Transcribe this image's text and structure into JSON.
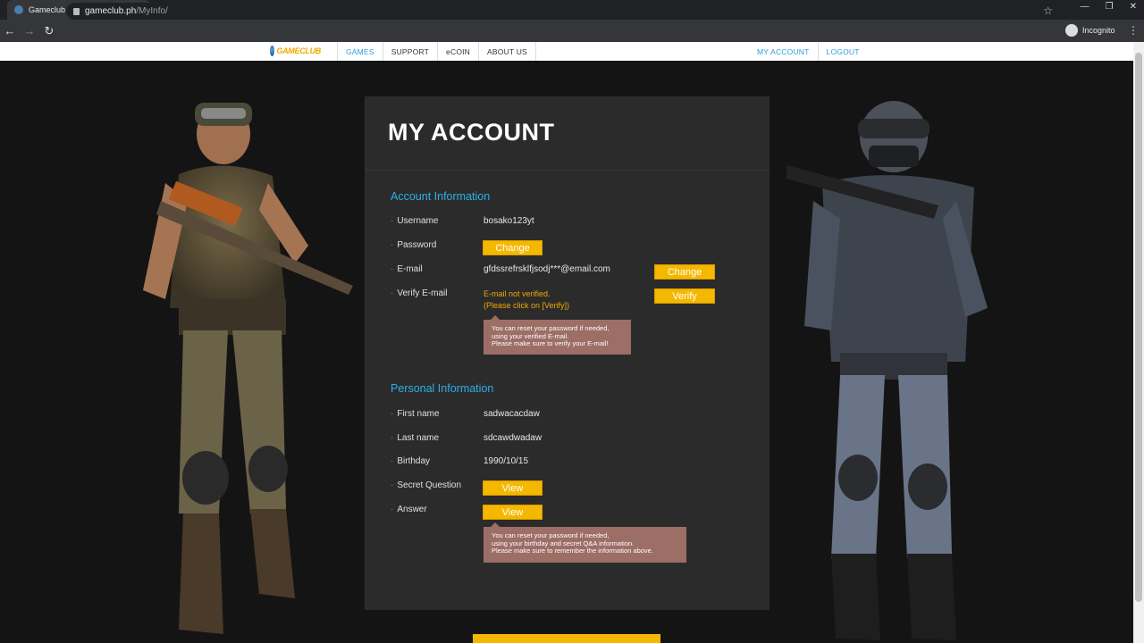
{
  "browser": {
    "tab_title": "Gameclub",
    "url_host": "gameclub.ph",
    "url_path": "/MyInfo/",
    "profile_label": "Incognito"
  },
  "site_nav": {
    "logo_text": "GAMECLUB",
    "items": [
      "GAMES",
      "SUPPORT",
      "eCOIN",
      "ABOUT US"
    ],
    "my_account": "MY ACCOUNT",
    "logout": "LOGOUT"
  },
  "page": {
    "title": "MY ACCOUNT",
    "account_section": "Account Information",
    "username_label": "Username",
    "username_value": "bosako123yt",
    "password_label": "Password",
    "password_button": "Change",
    "email_label": "E-mail",
    "email_value": "gfdssrefrsklfjsodj***@email.com",
    "email_button": "Change",
    "verify_label": "Verify E-mail",
    "verify_status": "E-mail not verified.",
    "verify_hint": "(Please click on [Verify])",
    "verify_button": "Verify",
    "verify_tip_1": "You can reset your password if needed,",
    "verify_tip_2": "using your verified E-mail.",
    "verify_tip_3": "Please make sure to verify your E-mail!",
    "personal_section": "Personal Information",
    "firstname_label": "First name",
    "firstname_value": "sadwacacdaw",
    "lastname_label": "Last name",
    "lastname_value": "sdcawdwadaw",
    "birthday_label": "Birthday",
    "birthday_value": "1990/10/15",
    "secret_label": "Secret Question",
    "secret_button": "View",
    "answer_label": "Answer",
    "answer_button": "View",
    "personal_tip_1": "You can reset your password if needed,",
    "personal_tip_2": "using your birthday and secret Q&A information.",
    "personal_tip_3": "Please make sure to remember the information above."
  },
  "colors": {
    "accent": "#2ab0e8",
    "button": "#f5b800",
    "panel": "#2c2b2b",
    "tip": "#9c6e66"
  }
}
